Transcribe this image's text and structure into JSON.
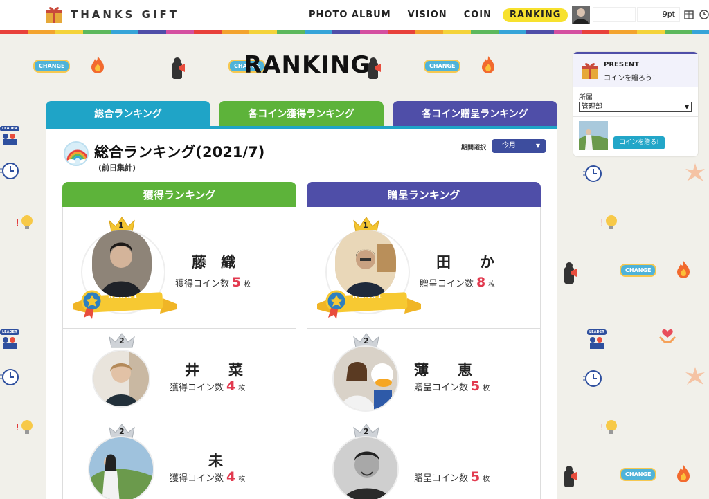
{
  "header": {
    "logo_text": "THANKS GIFT",
    "nav": [
      {
        "label": "PHOTO ALBUM"
      },
      {
        "label": "VISION"
      },
      {
        "label": "COIN"
      },
      {
        "label": "RANKING"
      }
    ],
    "points": "9pt"
  },
  "page_title": "RANKING",
  "tabs": [
    {
      "label": "総合ランキング",
      "color": "#1fa4c7"
    },
    {
      "label": "各コイン獲得ランキング",
      "color": "#5db33a"
    },
    {
      "label": "各コイン贈呈ランキング",
      "color": "#4f4ea8"
    }
  ],
  "section": {
    "title": "総合ランキング(2021/7)",
    "subtitle": "(前日集計)",
    "period_label": "期間選択",
    "period_value": "今月"
  },
  "received": {
    "header": "獲得ランキング",
    "header_color": "#5db33a",
    "entries": [
      {
        "rank": "1",
        "name": "藤　織",
        "count_label": "獲得コイン数",
        "count": "5",
        "unit": "枚",
        "rank_badge": "RANK1"
      },
      {
        "rank": "2",
        "name": "井　　菜",
        "count_label": "獲得コイン数",
        "count": "4",
        "unit": "枚"
      },
      {
        "rank": "2",
        "name": "未",
        "count_label": "獲得コイン数",
        "count": "4",
        "unit": "枚"
      }
    ]
  },
  "given": {
    "header": "贈呈ランキング",
    "header_color": "#4f4ea8",
    "entries": [
      {
        "rank": "1",
        "name": "田　　か",
        "count_label": "贈呈コイン数",
        "count": "8",
        "unit": "枚",
        "rank_badge": "RANK1"
      },
      {
        "rank": "2",
        "name": "薄　　恵",
        "count_label": "贈呈コイン数",
        "count": "5",
        "unit": "枚"
      },
      {
        "rank": "2",
        "name": "",
        "count_label": "贈呈コイン数",
        "count": "5",
        "unit": "枚"
      }
    ]
  },
  "present": {
    "title": "PRESENT",
    "subtitle": "コインを贈ろう！",
    "department_label": "所属",
    "department_value": "管理部",
    "button_label": "コインを贈る!"
  },
  "doodles": {
    "change_label": "CHANGE",
    "leader_label": "LEADER"
  }
}
